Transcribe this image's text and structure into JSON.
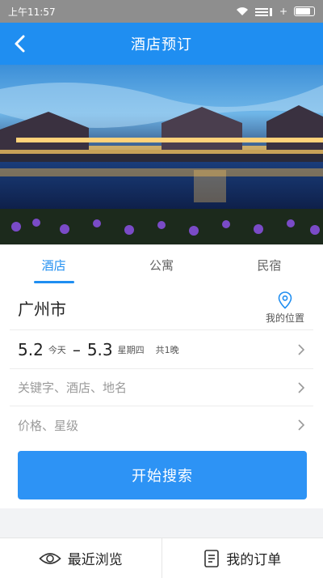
{
  "status_bar": {
    "time": "上午11:57"
  },
  "nav": {
    "title": "酒店预订"
  },
  "hero": {
    "image_icon": "hotel-lakeside-photo"
  },
  "tabs": [
    {
      "label": "酒店",
      "active": true
    },
    {
      "label": "公寓",
      "active": false
    },
    {
      "label": "民宿",
      "active": false
    }
  ],
  "search": {
    "city": "广州市",
    "my_location_label": "我的位置",
    "checkin_date": "5.2",
    "checkin_day": "今天",
    "separator": "–",
    "checkout_date": "5.3",
    "checkout_day": "星期四",
    "nights": "共1晚",
    "keyword_placeholder": "关键字、酒店、地名",
    "price_placeholder": "价格、星级",
    "search_button": "开始搜索"
  },
  "bottom_bar": {
    "recent_label": "最近浏览",
    "orders_label": "我的订单"
  },
  "colors": {
    "accent": "#1f8ef1",
    "button": "#2d93f5"
  }
}
